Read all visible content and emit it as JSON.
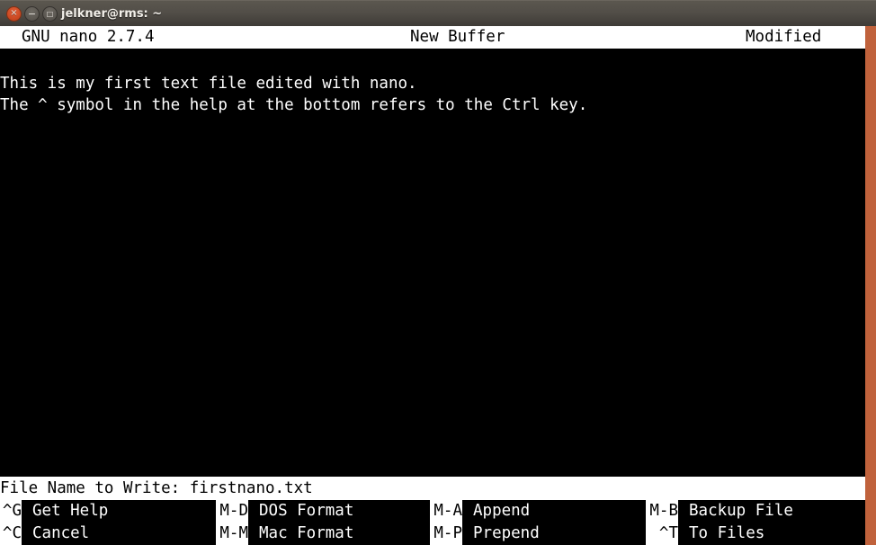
{
  "titlebar": {
    "title": "jelkner@rms: ~",
    "controls": [
      {
        "name": "close-button",
        "glyph": "×"
      },
      {
        "name": "minimize-button",
        "glyph": "−"
      },
      {
        "name": "maximize-button",
        "glyph": "□"
      }
    ]
  },
  "nano": {
    "header": {
      "version": "GNU nano 2.7.4",
      "buffer": "New Buffer",
      "modified": "Modified"
    },
    "editor": {
      "lines": [
        "This is my first text file edited with nano.",
        "The ^ symbol in the help at the bottom refers to the Ctrl key."
      ]
    },
    "prompt": {
      "label": "File Name to Write: ",
      "value": "firstnano.txt",
      "full": "File Name to Write: firstnano.txt"
    },
    "shortcuts": {
      "row1": [
        {
          "key": "^G",
          "label": "Get Help"
        },
        {
          "key": "M-D",
          "label": "DOS Format"
        },
        {
          "key": "M-A",
          "label": "Append"
        },
        {
          "key": "M-B",
          "label": "Backup File"
        }
      ],
      "row2": [
        {
          "key": "^C",
          "label": "Cancel"
        },
        {
          "key": "M-M",
          "label": "Mac Format"
        },
        {
          "key": "M-P",
          "label": "Prepend"
        },
        {
          "key": " ^T",
          "label": "To Files"
        }
      ]
    }
  },
  "colors": {
    "terminal_bg": "#000000",
    "terminal_fg": "#ffffff",
    "inverted_bg": "#ffffff",
    "inverted_fg": "#000000",
    "window_border": "#c0623c",
    "titlebar_bg": "#524e48",
    "close_button": "#c8461f"
  }
}
